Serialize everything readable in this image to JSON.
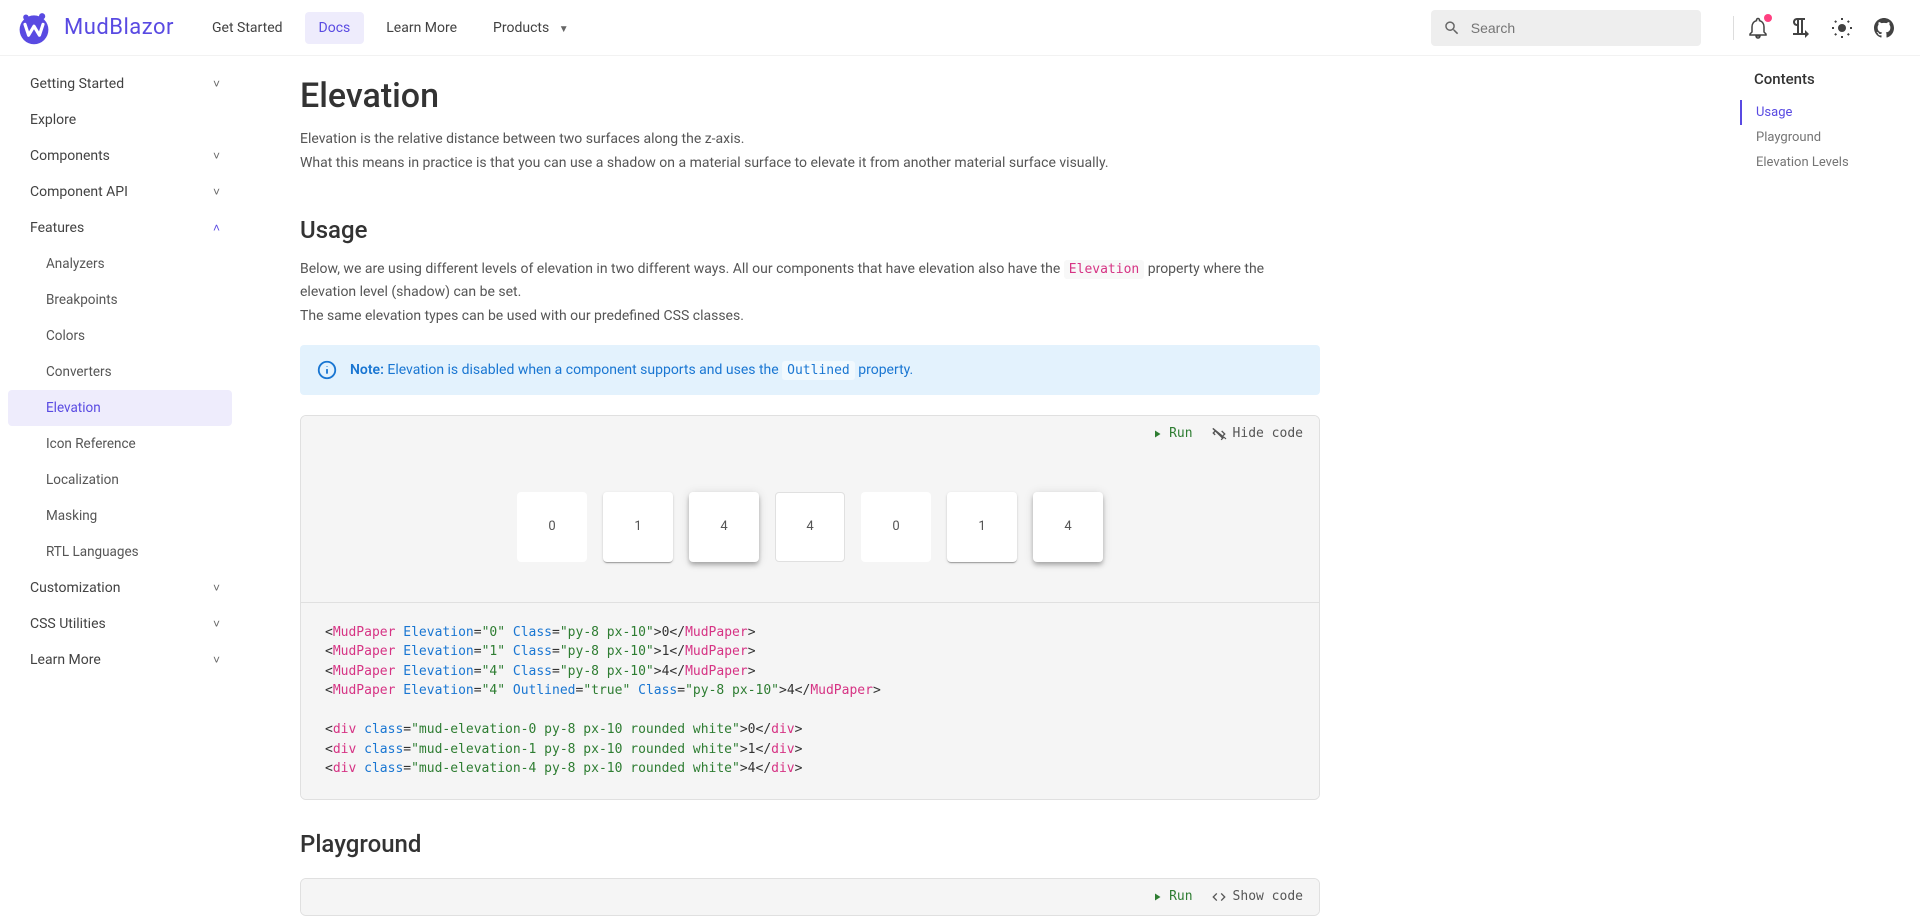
{
  "brand": "MudBlazor",
  "nav": [
    "Get Started",
    "Docs",
    "Learn More",
    "Products"
  ],
  "nav_active": "Docs",
  "search_placeholder": "Search",
  "sidebar": {
    "groups": [
      {
        "label": "Getting Started",
        "expandable": true,
        "expanded": false
      },
      {
        "label": "Explore",
        "expandable": false
      },
      {
        "label": "Components",
        "expandable": true,
        "expanded": false
      },
      {
        "label": "Component API",
        "expandable": true,
        "expanded": false
      },
      {
        "label": "Features",
        "expandable": true,
        "expanded": true,
        "children": [
          "Analyzers",
          "Breakpoints",
          "Colors",
          "Converters",
          "Elevation",
          "Icon Reference",
          "Localization",
          "Masking",
          "RTL Languages"
        ],
        "active_child": "Elevation"
      },
      {
        "label": "Customization",
        "expandable": true,
        "expanded": false
      },
      {
        "label": "CSS Utilities",
        "expandable": true,
        "expanded": false
      },
      {
        "label": "Learn More",
        "expandable": true,
        "expanded": false
      }
    ]
  },
  "page": {
    "title": "Elevation",
    "intro1": "Elevation is the relative distance between two surfaces along the z-axis.",
    "intro2": "What this means in practice is that you can use a shadow on a material surface to elevate it from another material surface visually.",
    "usage": {
      "heading": "Usage",
      "p1a": "Below, we are using different levels of elevation in two different ways. All our components that have elevation also have the ",
      "p1_code": "Elevation",
      "p1b": " property where the elevation level (shadow) can be set.",
      "p2": "The same elevation types can be used with our predefined CSS classes.",
      "note_label": "Note:",
      "note_a": " Elevation is disabled when a component supports and uses the ",
      "note_code": "Outlined",
      "note_b": " property.",
      "run": "Run",
      "hide": "Hide code",
      "papers": [
        {
          "v": "0",
          "cls": "elev-0"
        },
        {
          "v": "1",
          "cls": "elev-1"
        },
        {
          "v": "4",
          "cls": "elev-4"
        },
        {
          "v": "4",
          "cls": "outlined"
        },
        {
          "v": "0",
          "cls": "elev-0"
        },
        {
          "v": "1",
          "cls": "elev-1"
        },
        {
          "v": "4",
          "cls": "elev-4"
        }
      ]
    },
    "playground": {
      "heading": "Playground",
      "run": "Run",
      "show": "Show code"
    }
  },
  "toc": {
    "title": "Contents",
    "items": [
      "Usage",
      "Playground",
      "Elevation Levels"
    ],
    "active": "Usage"
  }
}
